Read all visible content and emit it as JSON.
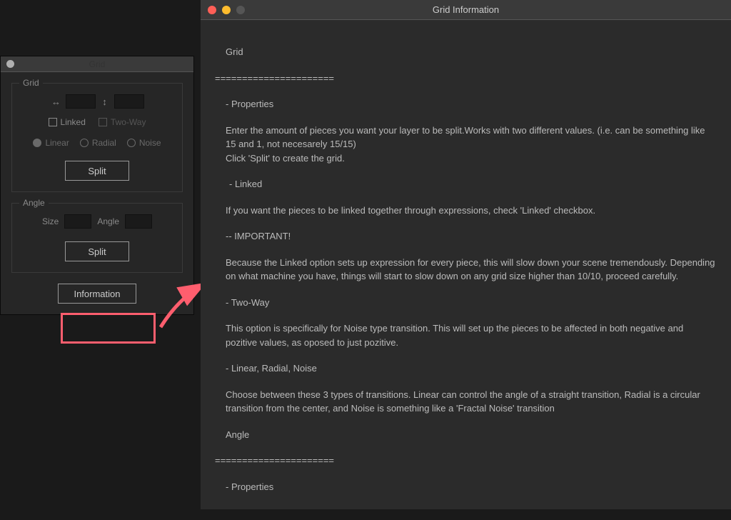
{
  "gridPanel": {
    "title": "Grid",
    "sections": {
      "grid": {
        "legend": "Grid",
        "linkedLabel": "Linked",
        "twoWayLabel": "Two-Way",
        "linear": "Linear",
        "radial": "Radial",
        "noise": "Noise",
        "splitBtn": "Split"
      },
      "angle": {
        "legend": "Angle",
        "sizeLabel": "Size",
        "angleLabel": "Angle",
        "splitBtn": "Split"
      }
    },
    "infoBtn": "Information"
  },
  "infoWindow": {
    "title": "Grid Information",
    "content": {
      "l1": "Grid",
      "l2": "======================",
      "l3": "- Properties",
      "l4": "Enter the amount of pieces you want your layer to be split.Works with two different values. (i.e. can be something like 15 and 1, not necesarely 15/15)",
      "l5": "Click 'Split' to create the grid.",
      "l6": "- Linked",
      "l7": "If you want the pieces to be linked together through expressions, check 'Linked' checkbox.",
      "l8": "-- IMPORTANT!",
      "l9": "Because the Linked option sets up expression for every piece, this will slow down your scene tremendously. Depending on what machine you have, things will start to slow down on any grid size higher than 10/10, proceed carefully.",
      "l10": "- Two-Way",
      "l11": "This option is specifically for Noise type transition. This will set up the pieces to be affected in both negative and pozitive values, as oposed to just pozitive.",
      "l12": "- Linear, Radial, Noise",
      "l13": "Choose between these 3 types of transitions. Linear can control the angle of a straight transition, Radial is a circular transition from the center, and Noise is something like a 'Fractal Noise' transition",
      "l14": "Angle",
      "l15": "======================",
      "l16": "- Properties"
    }
  }
}
